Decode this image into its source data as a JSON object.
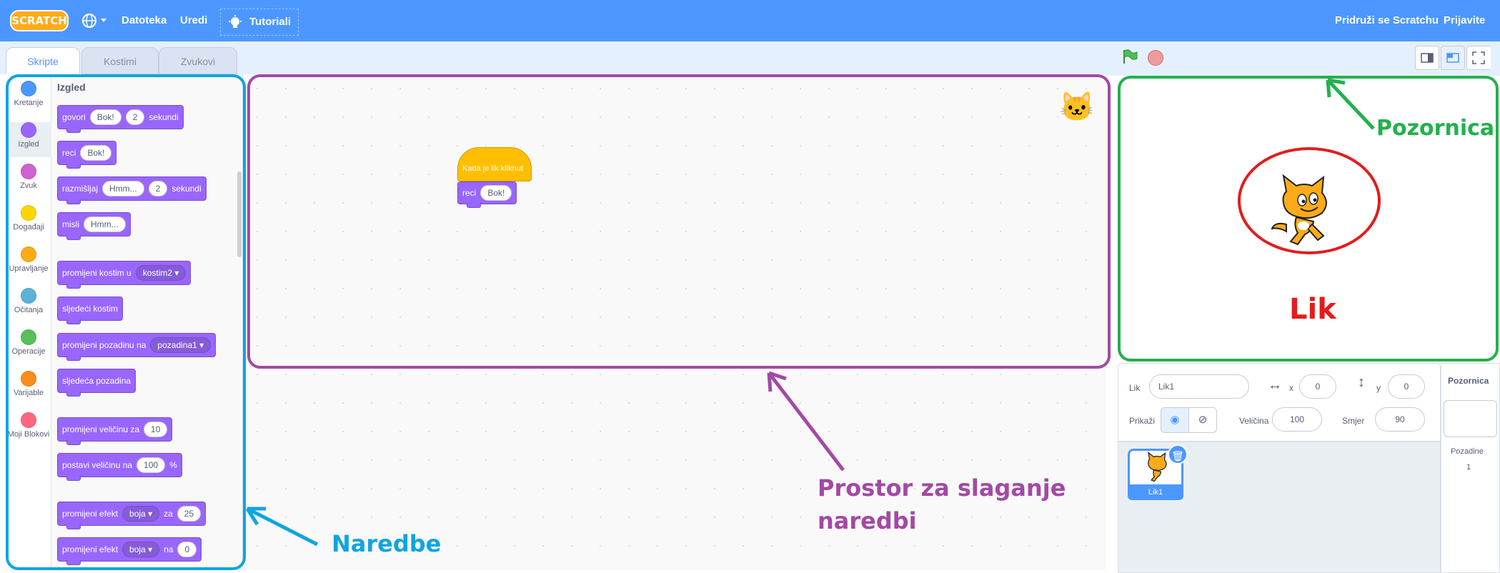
{
  "menu": {
    "logo": "SCRATCH",
    "file": "Datoteka",
    "edit": "Uredi",
    "tutorials": "Tutoriali",
    "join": "Pridruži se Scratchu",
    "signin": "Prijavite se"
  },
  "tabs": [
    "Skripte",
    "Kostimi",
    "Zvukovi"
  ],
  "categories": [
    {
      "label": "Kretanje",
      "color": "#4c97ff"
    },
    {
      "label": "Izgled",
      "color": "#9966ff"
    },
    {
      "label": "Zvuk",
      "color": "#cf63cf"
    },
    {
      "label": "Događaji",
      "color": "#ffd500"
    },
    {
      "label": "Upravljanje",
      "color": "#ffab19"
    },
    {
      "label": "Očitanja",
      "color": "#5cb1d6"
    },
    {
      "label": "Operacije",
      "color": "#59c059"
    },
    {
      "label": "Varijable",
      "color": "#ff8c1a"
    },
    {
      "label": "Moji Blokovi",
      "color": "#ff6680"
    }
  ],
  "palette": {
    "title": "Izgled",
    "say_for": {
      "a": "govori",
      "b": "Bok!",
      "c": "2",
      "d": "sekundi"
    },
    "say": {
      "a": "reci",
      "b": "Bok!"
    },
    "think_for": {
      "a": "razmišljaj",
      "b": "Hmm...",
      "c": "2",
      "d": "sekundi"
    },
    "think": {
      "a": "misli",
      "b": "Hmm..."
    },
    "switch_costume": {
      "a": "promijeni kostim u",
      "b": "kostim2"
    },
    "next_costume": {
      "a": "sljedeći kostim"
    },
    "switch_backdrop": {
      "a": "promijeni pozadinu na",
      "b": "pozadina1"
    },
    "next_backdrop": {
      "a": "sljedeća pozadina"
    },
    "change_size": {
      "a": "promijeni veličinu za",
      "b": "10"
    },
    "set_size": {
      "a": "postavi veličinu na",
      "b": "100",
      "c": "%"
    },
    "change_effect": {
      "a": "promijeni efekt",
      "b": "boja",
      "c": "za",
      "d": "25"
    },
    "set_effect": {
      "a": "promijeni efekt",
      "b": "boja",
      "c": "na",
      "d": "0"
    }
  },
  "script": {
    "hat": "Kada je lik kliknut",
    "say": "reci",
    "say_value": "Bok!"
  },
  "sprite_info": {
    "sprite_label": "Lik",
    "sprite_name": "Lik1",
    "x_label": "x",
    "x_value": "0",
    "y_label": "y",
    "y_value": "0",
    "show_label": "Prikaži",
    "size_label": "Veličina",
    "size_value": "100",
    "direction_label": "Smjer",
    "direction_value": "90"
  },
  "sprite_list": {
    "thumb_label": "Lik1"
  },
  "backdrop_panel": {
    "title": "Pozornica",
    "backdrops_label": "Pozadine",
    "backdrops_count": "1"
  },
  "annotations": {
    "commands": "Naredbe",
    "workspace_line1": "Prostor za slaganje",
    "workspace_line2": "naredbi",
    "stage": "Pozornica",
    "sprite": "Lik",
    "colors": {
      "commands": "#0ea5e0",
      "workspace": "#a349a4",
      "stage": "#22b14c",
      "sprite": "#e31c1c"
    }
  },
  "icons": [
    "globe-icon",
    "lightbulb-icon",
    "green-flag-icon",
    "stop-icon",
    "eye-icon",
    "eye-off-icon",
    "trash-icon"
  ]
}
